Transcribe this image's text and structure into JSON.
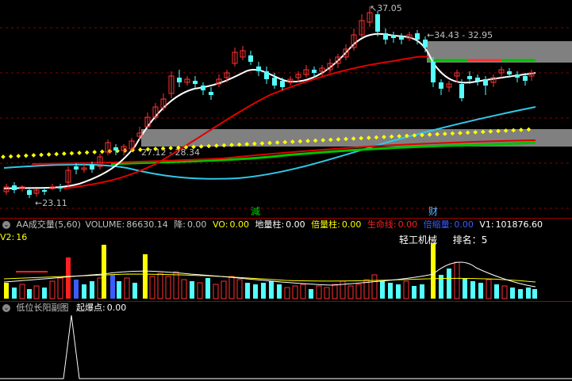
{
  "main_chart": {
    "price_high_label": "37.05",
    "range_label": "34.43 - 32.95",
    "support_label": "27.12 - 28.34",
    "low_label": "23.11",
    "marker_reduce": "減",
    "marker_wealth": "财",
    "colors": {
      "up": "#ff3232",
      "down": "#54ffff",
      "ma5": "#ffffff",
      "ma10": "#e00000",
      "ma20": "#30c8e8",
      "ma60": "#00c000",
      "band": "#808080",
      "dots": "#ffff00"
    }
  },
  "volume_panel": {
    "title": "AA成交量(5,60)",
    "volume_label": "VOLUME:",
    "volume_value": "86630.14",
    "drop_label": "降:",
    "drop_value": "0.00",
    "vo_label": "VO:",
    "vo_value": "0.00",
    "ground_label": "地量柱:",
    "ground_value": "0.00",
    "double_label": "倍量柱:",
    "double_value": "0.00",
    "life_label": "生命线:",
    "life_value": "0.00",
    "shrink_label": "倍缩量:",
    "shrink_value": "0.00",
    "v1_label": "V1:",
    "v1_value": "101876.60",
    "v2_label": "V2:",
    "v2_value": "16",
    "industry": "轻工机械",
    "rank_label": "排名：",
    "rank_value": "5"
  },
  "signal_panel": {
    "title": "低位长阳副图",
    "signal_label": "起爆点:",
    "signal_value": "0.00"
  }
}
